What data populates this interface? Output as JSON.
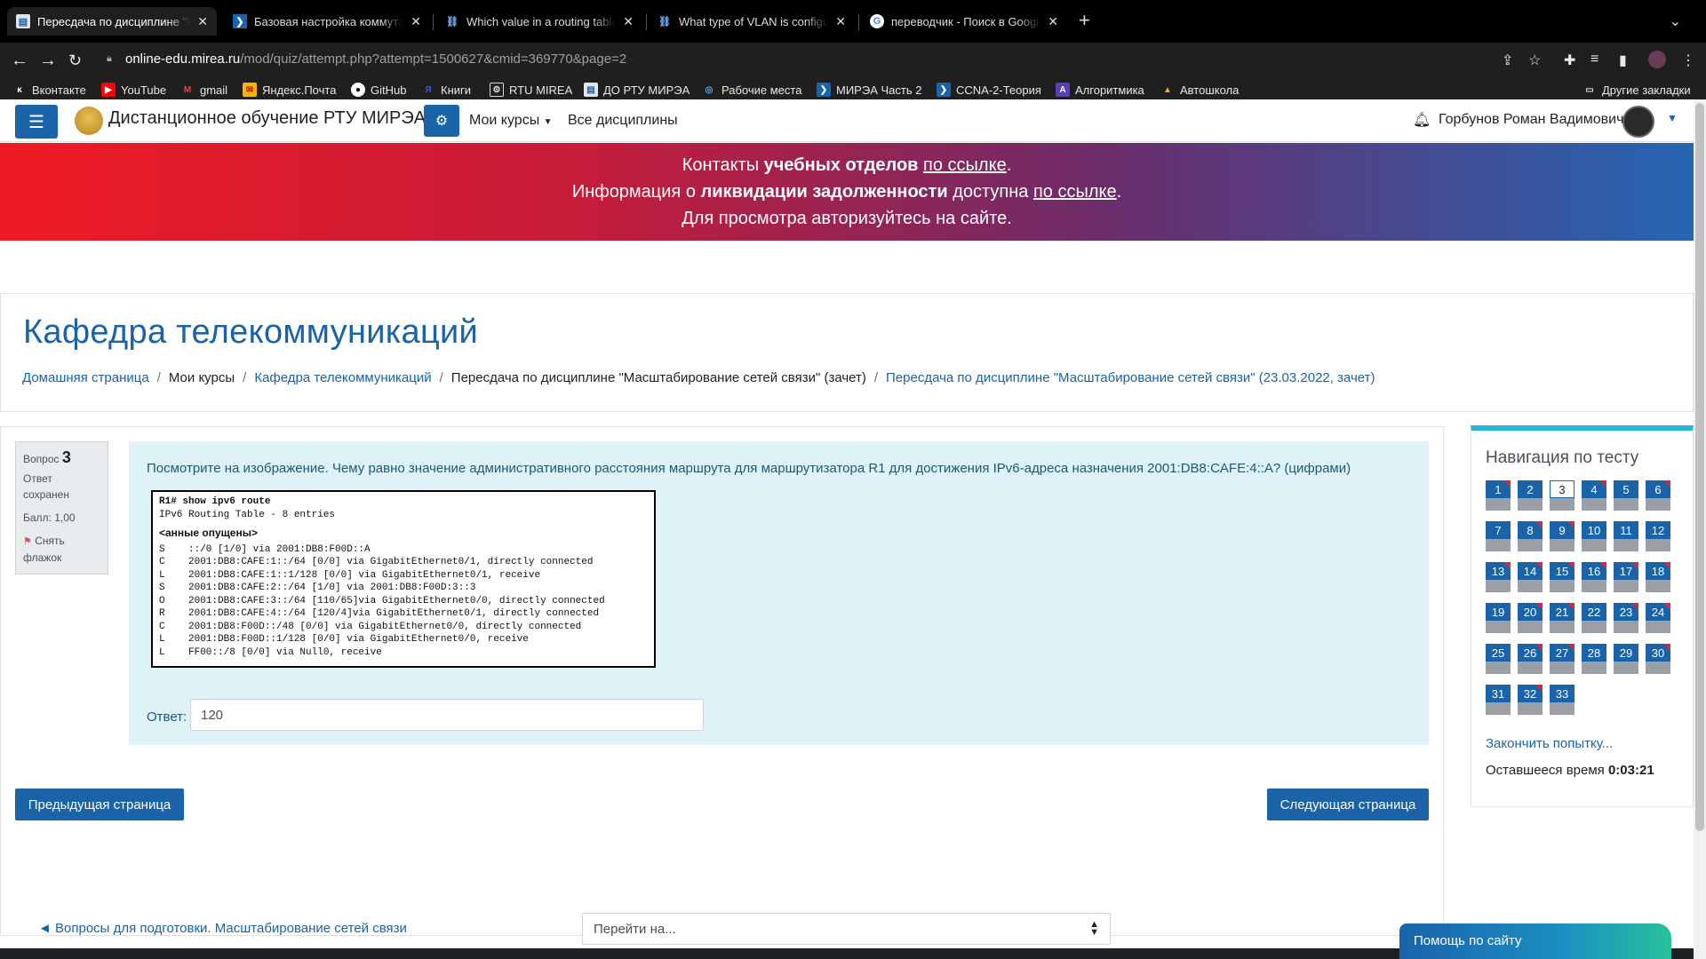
{
  "browser": {
    "tabs": [
      {
        "title": "Пересдача по дисциплине \"М",
        "active": true,
        "fav": "doc-icon"
      },
      {
        "title": "Базовая настройка коммутат",
        "active": false,
        "fav": "chevron-icon"
      },
      {
        "title": "Which value in a routing table r",
        "active": false,
        "fav": "link-icon"
      },
      {
        "title": "What type of VLAN is configure",
        "active": false,
        "fav": "link-icon"
      },
      {
        "title": "переводчик - Поиск в Google",
        "active": false,
        "fav": "google-icon"
      }
    ],
    "url_host": "online-edu.mirea.ru",
    "url_path": "/mod/quiz/attempt.php?attempt=1500627&cmid=369770&page=2",
    "bookmarks": [
      "Вконтакте",
      "YouTube",
      "gmail",
      "Яндекс.Почта",
      "GitHub",
      "Книги",
      "RTU MIREA",
      "ДО РТУ МИРЭА",
      "Рабочие места",
      "МИРЭА Часть 2",
      "CCNA-2-Теория",
      "Алгоритмика",
      "Автошкола"
    ],
    "other_bookmarks": "Другие закладки"
  },
  "navbar": {
    "site_name": "Дистанционное обучение РТУ МИРЭА",
    "my_courses": "Мои курсы",
    "all_disciplines": "Все дисциплины",
    "user_name": "Горбунов Роман Вадимович"
  },
  "banner": {
    "l1_a": "Контакты ",
    "l1_b": "учебных отделов",
    "l1_c": " ",
    "l1_link": "по ссылке",
    "l1_d": ".",
    "l2_a": "Информация о ",
    "l2_b": "ликвидации задолженности",
    "l2_c": " доступна ",
    "l2_link": "по ссылке",
    "l2_d": ".",
    "l3": "Для просмотра авторизуйтесь на сайте."
  },
  "header": {
    "title": "Кафедра телекоммуникаций",
    "breadcrumbs": [
      "Домашняя страница",
      "Мои курсы",
      "Кафедра телекоммуникаций",
      "Пересдача по дисциплине \"Масштабирование сетей связи\" (зачет)",
      "Пересдача по дисциплине \"Масштабирование сетей связи\" (23.03.2022, зачет)"
    ]
  },
  "question": {
    "label": "Вопрос",
    "number": "3",
    "state_1": "Ответ",
    "state_2": "сохранен",
    "grade": "Балл: 1,00",
    "flag_1": "Снять",
    "flag_2": "флажок",
    "text": "Посмотрите на изображение. Чему равно значение административного расстояния маршрута для маршрутизатора R1 для достижения IPv6-адреса назначения 2001:DB8:CAFE:4::A? (цифрами)",
    "terminal": {
      "cmd": "R1# show ipv6 route",
      "table": "IPv6 Routing Table - 8 entries",
      "omitted": "<анные опущены>",
      "routes": [
        "S    ::/0 [1/0] via 2001:DB8:F00D::A",
        "C    2001:DB8:CAFE:1::/64 [0/0] via GigabitEthernet0/1, directly connected",
        "L    2001:DB8:CAFE:1::1/128 [0/0] via GigabitEthernet0/1, receive",
        "S    2001:DB8:CAFE:2::/64 [1/0] via 2001:DB8:F00D:3::3",
        "O    2001:DB8:CAFE:3::/64 [110/65]via GigabitEthernet0/0, directly connected",
        "R    2001:DB8:CAFE:4::/64 [120/4]via GigabitEthernet0/1, directly connected",
        "C    2001:DB8:F00D::/48 [0/0] via GigabitEthernet0/0, directly connected",
        "L    2001:DB8:F00D::1/128 [0/0] via GigabitEthernet0/0, receive",
        "L    FF00::/8 [0/0] via Null0, receive"
      ]
    },
    "answer_label": "Ответ:",
    "answer_value": "120"
  },
  "buttons": {
    "prev": "Предыдущая страница",
    "next": "Следующая страница"
  },
  "quiz_nav": {
    "title": "Навигация по тесту",
    "questions": [
      "1",
      "2",
      "3",
      "4",
      "5",
      "6",
      "7",
      "8",
      "9",
      "10",
      "11",
      "12",
      "13",
      "14",
      "15",
      "16",
      "17",
      "18",
      "19",
      "20",
      "21",
      "22",
      "23",
      "24",
      "25",
      "26",
      "27",
      "28",
      "29",
      "30",
      "31",
      "32",
      "33"
    ],
    "flagged": [
      "1",
      "4",
      "6",
      "8",
      "9",
      "13",
      "14",
      "15",
      "16",
      "17",
      "18",
      "20",
      "21",
      "23",
      "24",
      "26",
      "27",
      "30",
      "32"
    ],
    "current": "3",
    "finish": "Закончить попытку...",
    "time_label": "Оставшееся время ",
    "time_value": "0:03:21"
  },
  "footer": {
    "prev_link": "◄ Вопросы для подготовки. Масштабирование  сетей связи",
    "jump_placeholder": "Перейти на...",
    "help": "Помощь по сайту"
  },
  "colors": {
    "primary": "#1a63a8",
    "question_bg": "#def2f8",
    "flag_red": "#e0263a",
    "nav_accent": "#29b6d7"
  }
}
